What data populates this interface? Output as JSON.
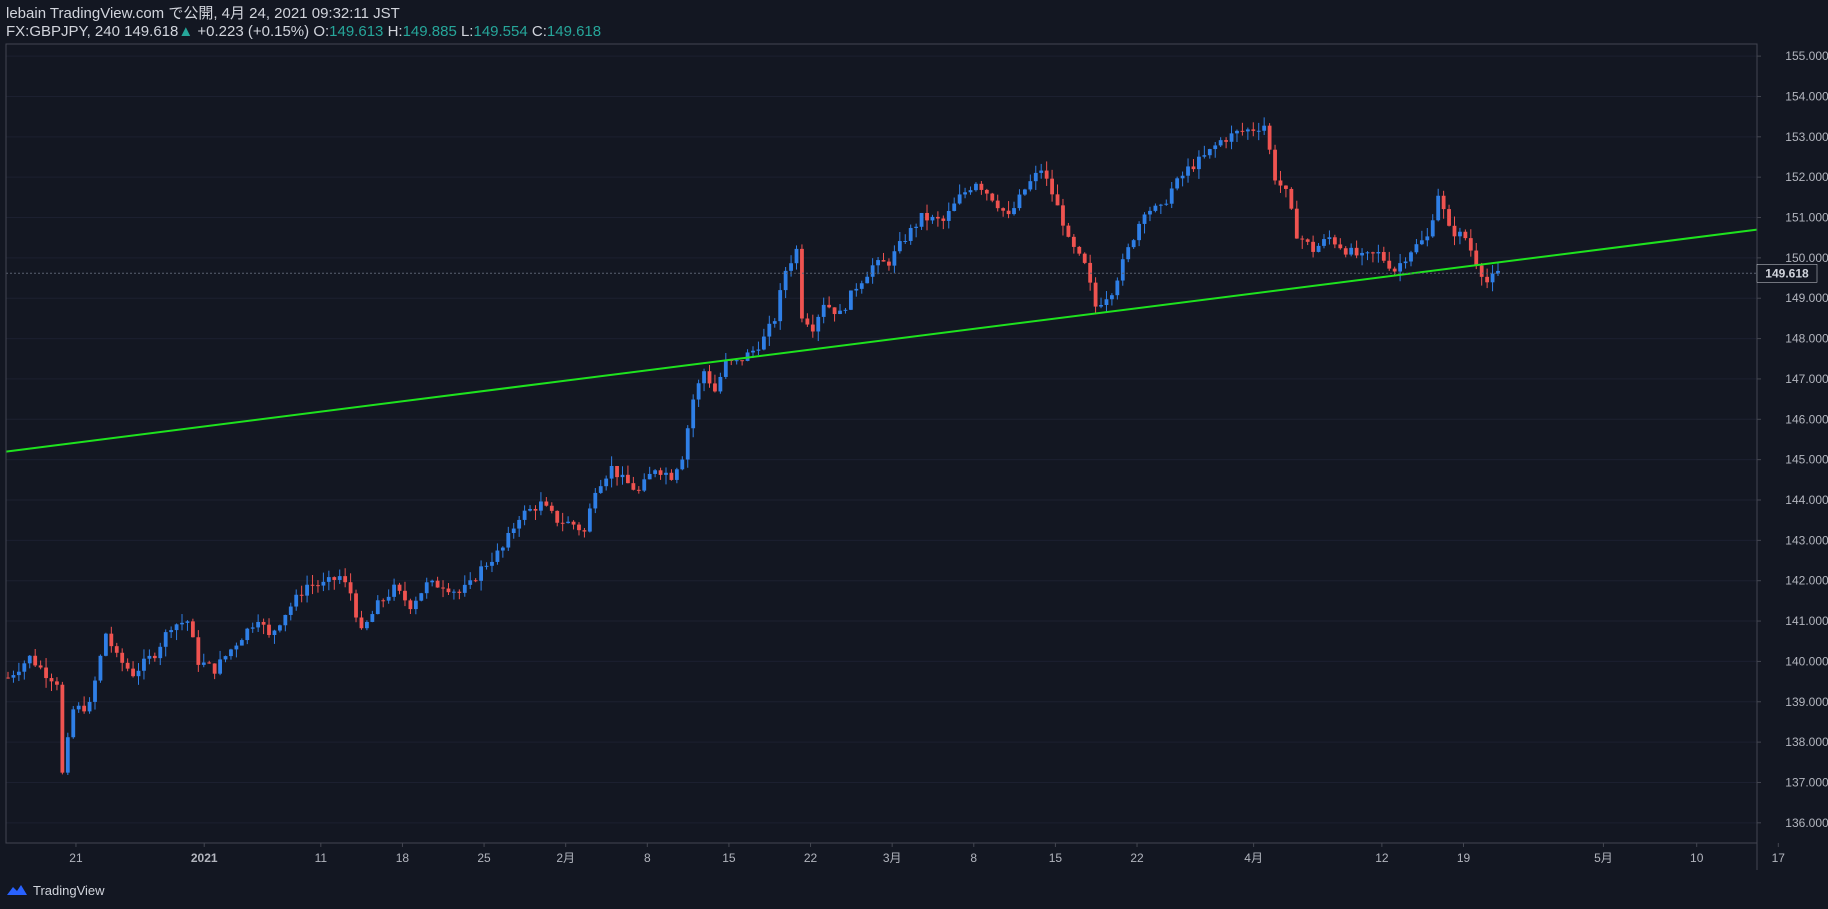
{
  "header": {
    "line1": "lebain TradingView.com で公開, 4月 24, 2021 09:32:11 JST",
    "symbol": "FX:GBPJPY, 240",
    "last": "149.618",
    "change": "+0.223 (+0.15%)",
    "o_label": "O:",
    "o": "149.613",
    "h_label": "H:",
    "h": "149.885",
    "l_label": "L:",
    "l": "149.554",
    "c_label": "C:",
    "c": "149.618"
  },
  "footer": {
    "brand": "TradingView",
    "logo_icon": "tradingview-logo-icon"
  },
  "colors": {
    "background": "#131722",
    "up": "#2f7fe6",
    "down": "#ef5350",
    "trendline": "#1ee31e",
    "axis_text": "#b2b5be",
    "grid": "#2a2e39"
  },
  "chart_data": {
    "type": "candlestick",
    "symbol": "FX:GBPJPY",
    "interval": "240",
    "ylim": [
      135.5,
      155.3
    ],
    "y_ticks": [
      "136.000",
      "137.000",
      "138.000",
      "139.000",
      "140.000",
      "141.000",
      "142.000",
      "143.000",
      "144.000",
      "145.000",
      "146.000",
      "147.000",
      "148.000",
      "149.000",
      "150.000",
      "151.000",
      "152.000",
      "153.000",
      "154.000",
      "155.000"
    ],
    "x_ticks": [
      "21",
      "2021",
      "11",
      "18",
      "25",
      "2月",
      "8",
      "15",
      "22",
      "3月",
      "8",
      "15",
      "22",
      "4月",
      "12",
      "19",
      "5月",
      "10",
      "17"
    ],
    "current_price": "149.618",
    "trendline": {
      "start_date": "2020-12-15",
      "start_price": 145.2,
      "end_date": "2021-05-17",
      "end_price": 150.7
    },
    "price_path": [
      [
        0,
        139.6
      ],
      [
        4,
        140.1
      ],
      [
        7,
        139.7
      ],
      [
        9,
        139.5
      ],
      [
        10,
        137.2
      ],
      [
        12,
        138.8
      ],
      [
        15,
        138.9
      ],
      [
        18,
        140.7
      ],
      [
        20,
        140.1
      ],
      [
        23,
        139.7
      ],
      [
        27,
        140.2
      ],
      [
        30,
        140.9
      ],
      [
        33,
        141.0
      ],
      [
        35,
        140.0
      ],
      [
        38,
        139.8
      ],
      [
        41,
        140.3
      ],
      [
        46,
        141.1
      ],
      [
        48,
        140.6
      ],
      [
        51,
        141.2
      ],
      [
        55,
        141.9
      ],
      [
        58,
        141.9
      ],
      [
        61,
        142.1
      ],
      [
        63,
        141.7
      ],
      [
        65,
        140.7
      ],
      [
        68,
        141.4
      ],
      [
        71,
        141.8
      ],
      [
        74,
        141.4
      ],
      [
        77,
        141.9
      ],
      [
        80,
        141.9
      ],
      [
        83,
        141.7
      ],
      [
        85,
        141.9
      ],
      [
        87,
        142.3
      ],
      [
        91,
        142.8
      ],
      [
        94,
        143.6
      ],
      [
        98,
        143.9
      ],
      [
        101,
        143.5
      ],
      [
        104,
        143.4
      ],
      [
        106,
        143.2
      ],
      [
        108,
        144.3
      ],
      [
        111,
        144.8
      ],
      [
        113,
        144.5
      ],
      [
        116,
        144.2
      ],
      [
        119,
        144.8
      ],
      [
        122,
        144.6
      ],
      [
        124,
        145.1
      ],
      [
        126,
        146.5
      ],
      [
        128,
        147.2
      ],
      [
        130,
        146.7
      ],
      [
        132,
        147.4
      ],
      [
        134,
        147.4
      ],
      [
        137,
        147.7
      ],
      [
        139,
        148.0
      ],
      [
        141,
        148.5
      ],
      [
        143,
        149.7
      ],
      [
        145,
        150.2
      ],
      [
        146,
        148.6
      ],
      [
        148,
        148.3
      ],
      [
        150,
        148.9
      ],
      [
        153,
        148.6
      ],
      [
        156,
        149.3
      ],
      [
        159,
        149.8
      ],
      [
        162,
        149.9
      ],
      [
        165,
        150.5
      ],
      [
        168,
        151.0
      ],
      [
        172,
        150.9
      ],
      [
        175,
        151.5
      ],
      [
        178,
        151.9
      ],
      [
        181,
        151.5
      ],
      [
        184,
        151.0
      ],
      [
        187,
        151.7
      ],
      [
        190,
        152.2
      ],
      [
        192,
        151.6
      ],
      [
        194,
        150.9
      ],
      [
        195,
        150.4
      ],
      [
        198,
        149.8
      ],
      [
        200,
        148.8
      ],
      [
        203,
        149.2
      ],
      [
        206,
        150.2
      ],
      [
        209,
        151.2
      ],
      [
        212,
        151.2
      ],
      [
        214,
        151.7
      ],
      [
        217,
        152.2
      ],
      [
        220,
        152.5
      ],
      [
        223,
        152.9
      ],
      [
        226,
        153.1
      ],
      [
        229,
        153.2
      ],
      [
        231,
        153.3
      ],
      [
        233,
        152.0
      ],
      [
        235,
        151.6
      ],
      [
        237,
        150.6
      ],
      [
        240,
        150.2
      ],
      [
        243,
        150.5
      ],
      [
        246,
        150.2
      ],
      [
        249,
        150.0
      ],
      [
        252,
        150.1
      ],
      [
        255,
        149.7
      ],
      [
        258,
        150.2
      ],
      [
        261,
        150.5
      ],
      [
        263,
        151.6
      ],
      [
        265,
        150.7
      ],
      [
        268,
        150.5
      ],
      [
        270,
        149.9
      ],
      [
        272,
        149.4
      ],
      [
        274,
        149.6
      ]
    ]
  }
}
